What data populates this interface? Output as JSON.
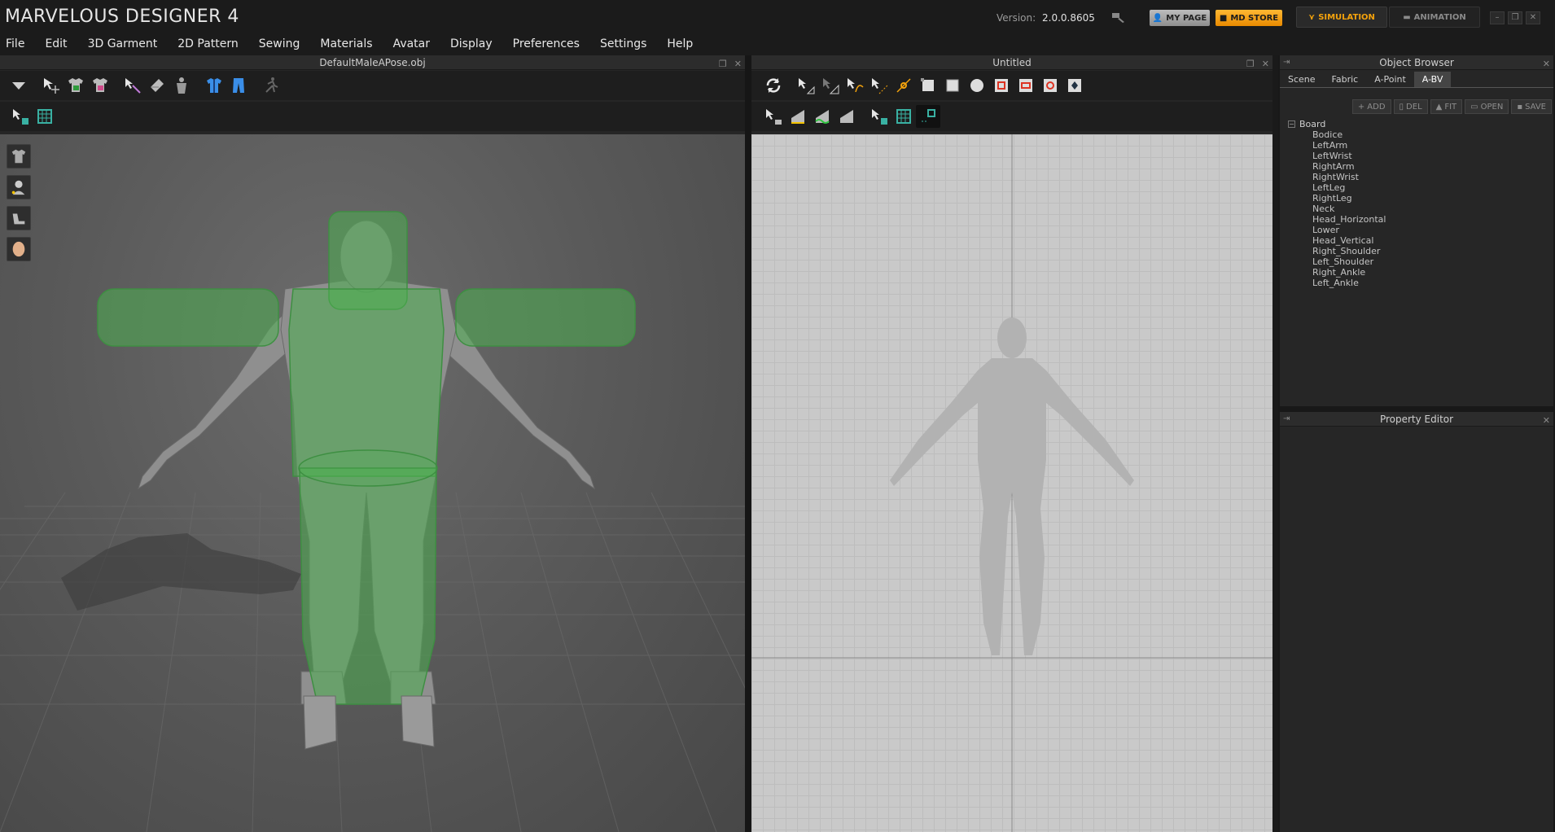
{
  "app": {
    "title": "MARVELOUS DESIGNER 4",
    "version_label": "Version:",
    "version_value": "2.0.0.8605",
    "mypage_label": "MY PAGE",
    "mdstore_label": "MD STORE",
    "simulation_label": "SIMULATION",
    "animation_label": "ANIMATION",
    "accent_orange": "#f3a20c"
  },
  "menu": [
    "File",
    "Edit",
    "3D Garment",
    "2D Pattern",
    "Sewing",
    "Materials",
    "Avatar",
    "Display",
    "Preferences",
    "Settings",
    "Help"
  ],
  "left_panel": {
    "title": "DefaultMaleAPose.obj"
  },
  "mid_panel": {
    "title": "Untitled"
  },
  "object_browser": {
    "title": "Object Browser",
    "tabs": [
      "Scene",
      "Fabric",
      "A-Point",
      "A-BV"
    ],
    "active_tab": "A-BV",
    "buttons": {
      "add": "ADD",
      "del": "DEL",
      "fit": "FIT",
      "open": "OPEN",
      "save": "SAVE"
    },
    "root": "Board",
    "children": [
      "Bodice",
      "LeftArm",
      "LeftWrist",
      "RightArm",
      "RightWrist",
      "LeftLeg",
      "RightLeg",
      "Neck",
      "Head_Horizontal",
      "Lower",
      "Head_Vertical",
      "Right_Shoulder",
      "Left_Shoulder",
      "Right_Ankle",
      "Left_Ankle"
    ]
  },
  "property_editor": {
    "title": "Property Editor"
  },
  "colors": {
    "bounding_volume_green": "#4caf50",
    "background_dark": "#1b1b1b"
  }
}
